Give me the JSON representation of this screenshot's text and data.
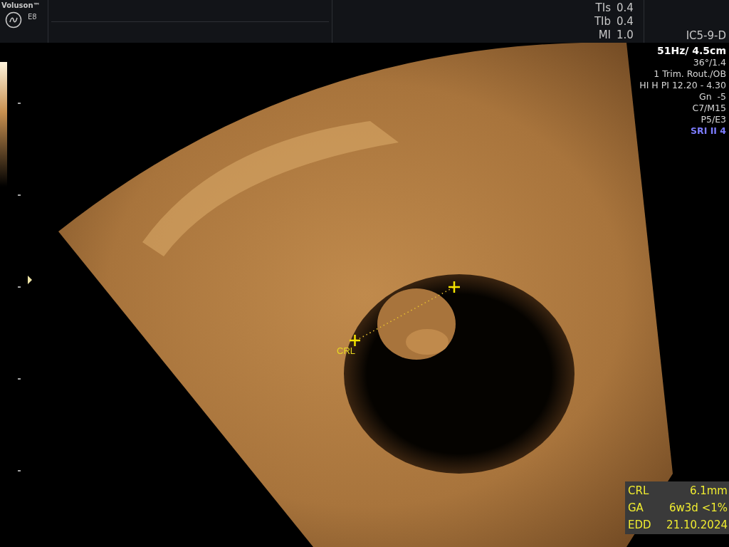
{
  "header": {
    "brand": "Voluson™",
    "model": "E8",
    "probe": "IC5-9-D",
    "indices": [
      {
        "label": "TIs",
        "value": "0.4"
      },
      {
        "label": "TIb",
        "value": "0.4"
      },
      {
        "label": "MI",
        "value": "1.0"
      }
    ]
  },
  "parameters": [
    {
      "text": "51Hz/ 4.5cm",
      "kind": "primary"
    },
    {
      "text": "36°/1.4",
      "kind": "normal"
    },
    {
      "text": "1 Trim. Rout./OB",
      "kind": "normal"
    },
    {
      "text": "HI H PI 12.20 - 4.30",
      "kind": "normal"
    },
    {
      "text": "Gn  -5",
      "kind": "normal"
    },
    {
      "text": "C7/M15",
      "kind": "normal"
    },
    {
      "text": "P5/E3",
      "kind": "normal"
    },
    {
      "text": "SRI II 4",
      "kind": "highlight"
    }
  ],
  "caliper": {
    "label": "CRL"
  },
  "measurements": [
    {
      "label": "CRL",
      "value": "6.1mm"
    },
    {
      "label": "GA",
      "value": "6w3d <1%"
    },
    {
      "label": "EDD",
      "value": "21.10.2024"
    }
  ]
}
